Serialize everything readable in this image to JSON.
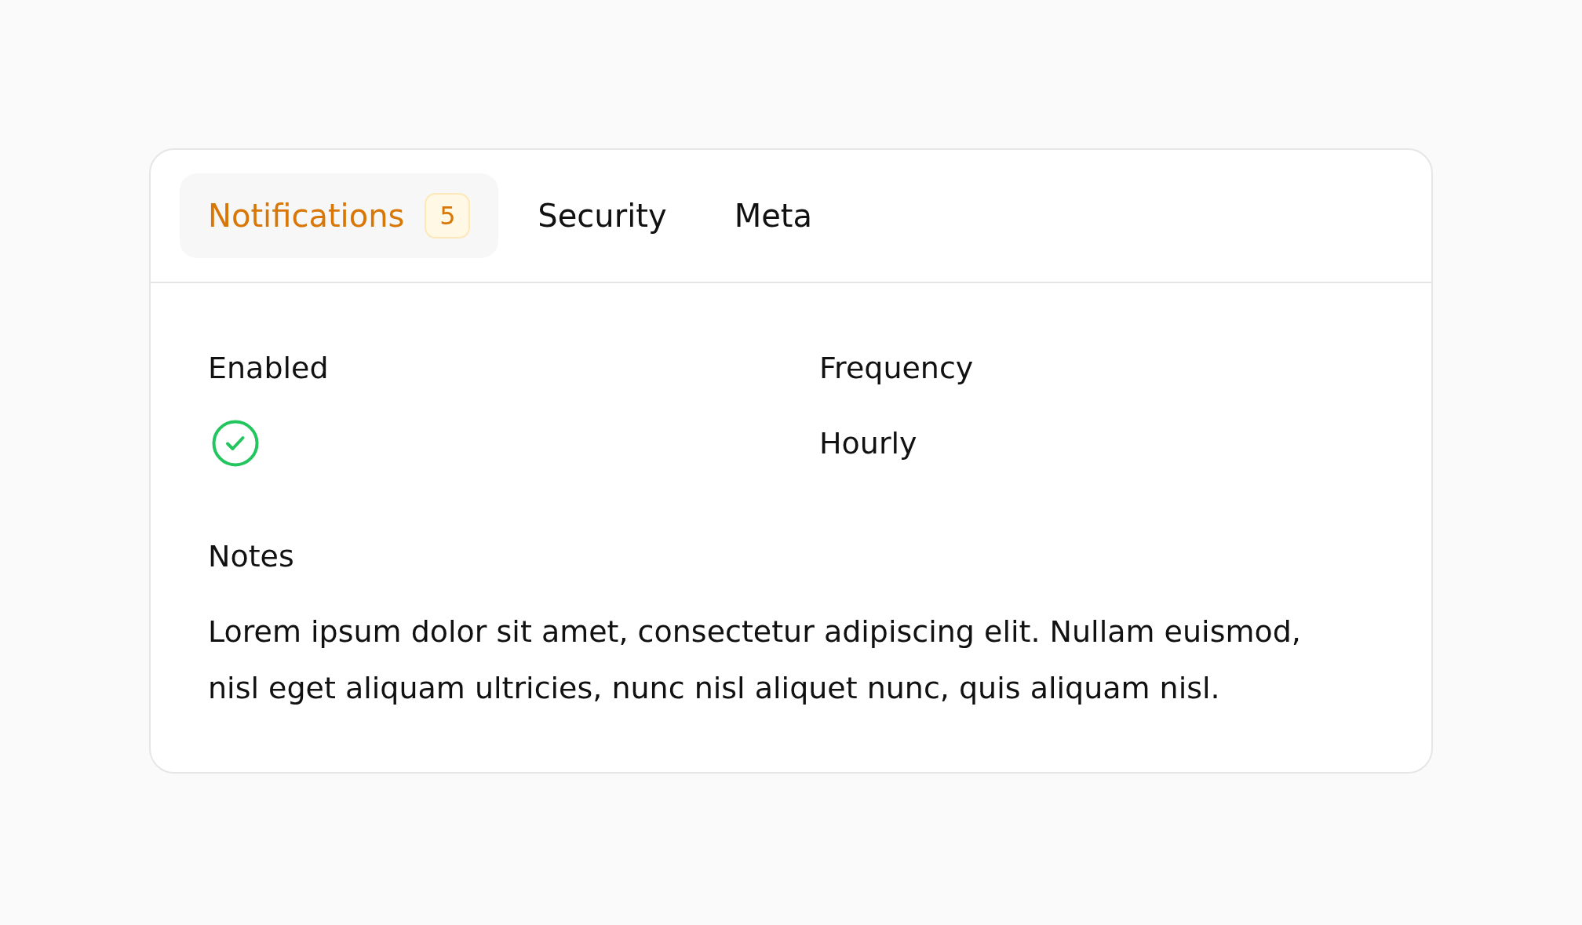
{
  "tabs": [
    {
      "label": "Notifications",
      "selected": true,
      "badge": "5"
    },
    {
      "label": "Security",
      "selected": false
    },
    {
      "label": "Meta",
      "selected": false
    }
  ],
  "fields": [
    {
      "kind": "check",
      "label": "Enabled",
      "checked": true
    },
    {
      "kind": "text",
      "label": "Frequency",
      "value": "Hourly"
    },
    {
      "kind": "paragraph",
      "label": "Notes",
      "value": "Lorem ipsum dolor sit amet, consectetur adipiscing elit. Nullam euismod, nisl eget aliquam ultricies, nunc nisl aliquet nunc, quis aliquam nisl."
    }
  ]
}
